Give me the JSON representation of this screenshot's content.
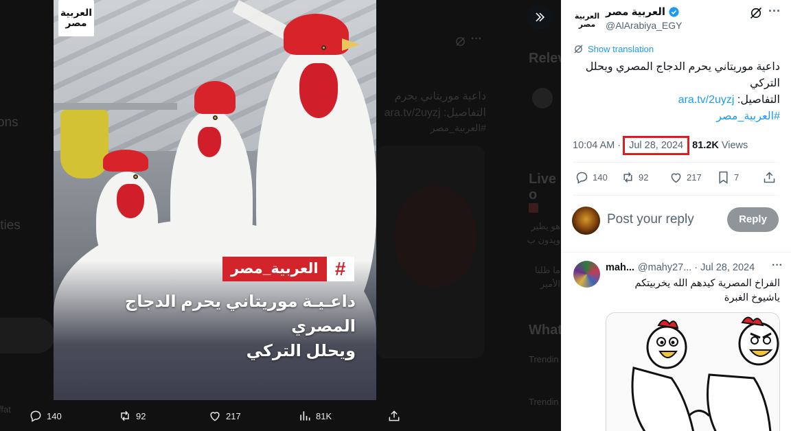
{
  "background": {
    "left_fragment_1": "ons",
    "left_fragment_2": "ities",
    "left_fragment_3": "ffat",
    "right_heading_1": "Relev",
    "right_heading_2": "Live o",
    "right_heading_3": "What",
    "trending_1": "Trendin",
    "trending_2": "Trendin",
    "ghost_text_1": "داعية موريتاني يحرم",
    "ghost_text_2": "التفاصيل: ara.tv/2uyzj",
    "ghost_text_3": "#العربية_مصر",
    "ghost_text_4": "هو يطير",
    "ghost_text_5": "ويدون ب",
    "ghost_text_6": "ما ظلنا",
    "ghost_text_7": "الأمير"
  },
  "media": {
    "logo_text": "العربية مصر",
    "hashtag_label": "العربية_مصر",
    "hash_symbol": "#",
    "caption_line1": "داعـيـة موريتاني يحرم الدجاج المصري",
    "caption_line2": "ويحلل التركي"
  },
  "media_actions": {
    "replies": "140",
    "reposts": "92",
    "likes": "217",
    "views": "81K"
  },
  "post": {
    "author_name": "العربية مصر",
    "handle": "@AlArabiya_EGY",
    "avatar_text": "العربية مصر",
    "translate_label": "Show translation",
    "text_line1": "داعية موريتاني يحرم الدجاج المصري ويحلل التركي",
    "details_label": "التفاصيل:",
    "link": "ara.tv/2uyzj",
    "hashtag": "#العربية_مصر",
    "time": "10:04 AM",
    "date": "Jul 28, 2024",
    "views_count": "81.2K",
    "views_label": "Views",
    "replies": "140",
    "reposts": "92",
    "likes": "217",
    "bookmarks": "7",
    "accent_color": "#1d9bf0",
    "highlight_color": "#e11b22"
  },
  "reply_box": {
    "placeholder": "Post your reply",
    "button_label": "Reply"
  },
  "comment": {
    "name": "mah...",
    "handle": "@mahy27...",
    "date": "Jul 28, 2024",
    "text": "الفراخ المصرية كيدهم الله يخربيتكم ياشيوخ الغبرة"
  }
}
